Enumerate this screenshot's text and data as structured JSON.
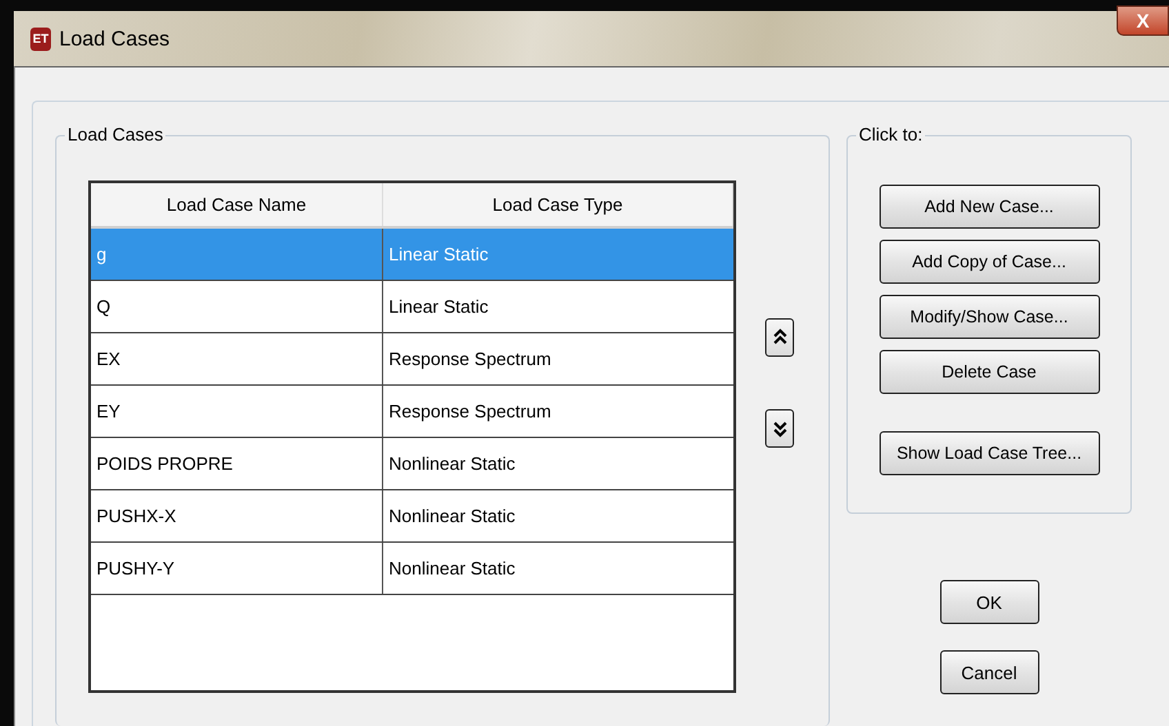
{
  "window": {
    "title": "Load Cases",
    "icon_text": "ET",
    "close_label": "X"
  },
  "load_cases_group": {
    "title": "Load Cases",
    "table": {
      "columns": [
        "Load Case Name",
        "Load Case Type"
      ],
      "rows": [
        {
          "name": "g",
          "type": "Linear Static",
          "selected": true
        },
        {
          "name": "Q",
          "type": "Linear Static",
          "selected": false
        },
        {
          "name": "EX",
          "type": "Response Spectrum",
          "selected": false
        },
        {
          "name": "EY",
          "type": "Response Spectrum",
          "selected": false
        },
        {
          "name": "POIDS PROPRE",
          "type": "Nonlinear Static",
          "selected": false
        },
        {
          "name": "PUSHX-X",
          "type": "Nonlinear Static",
          "selected": false
        },
        {
          "name": "PUSHY-Y",
          "type": "Nonlinear Static",
          "selected": false
        }
      ]
    }
  },
  "click_to_group": {
    "title": "Click to:",
    "buttons": [
      {
        "label": "Add New Case...",
        "spaced": false
      },
      {
        "label": "Add Copy of Case...",
        "spaced": false
      },
      {
        "label": "Modify/Show Case...",
        "spaced": false
      },
      {
        "label": "Delete Case",
        "spaced": false
      },
      {
        "label": "Show Load Case Tree...",
        "spaced": true
      }
    ]
  },
  "dialog_buttons": [
    "OK",
    "Cancel"
  ]
}
